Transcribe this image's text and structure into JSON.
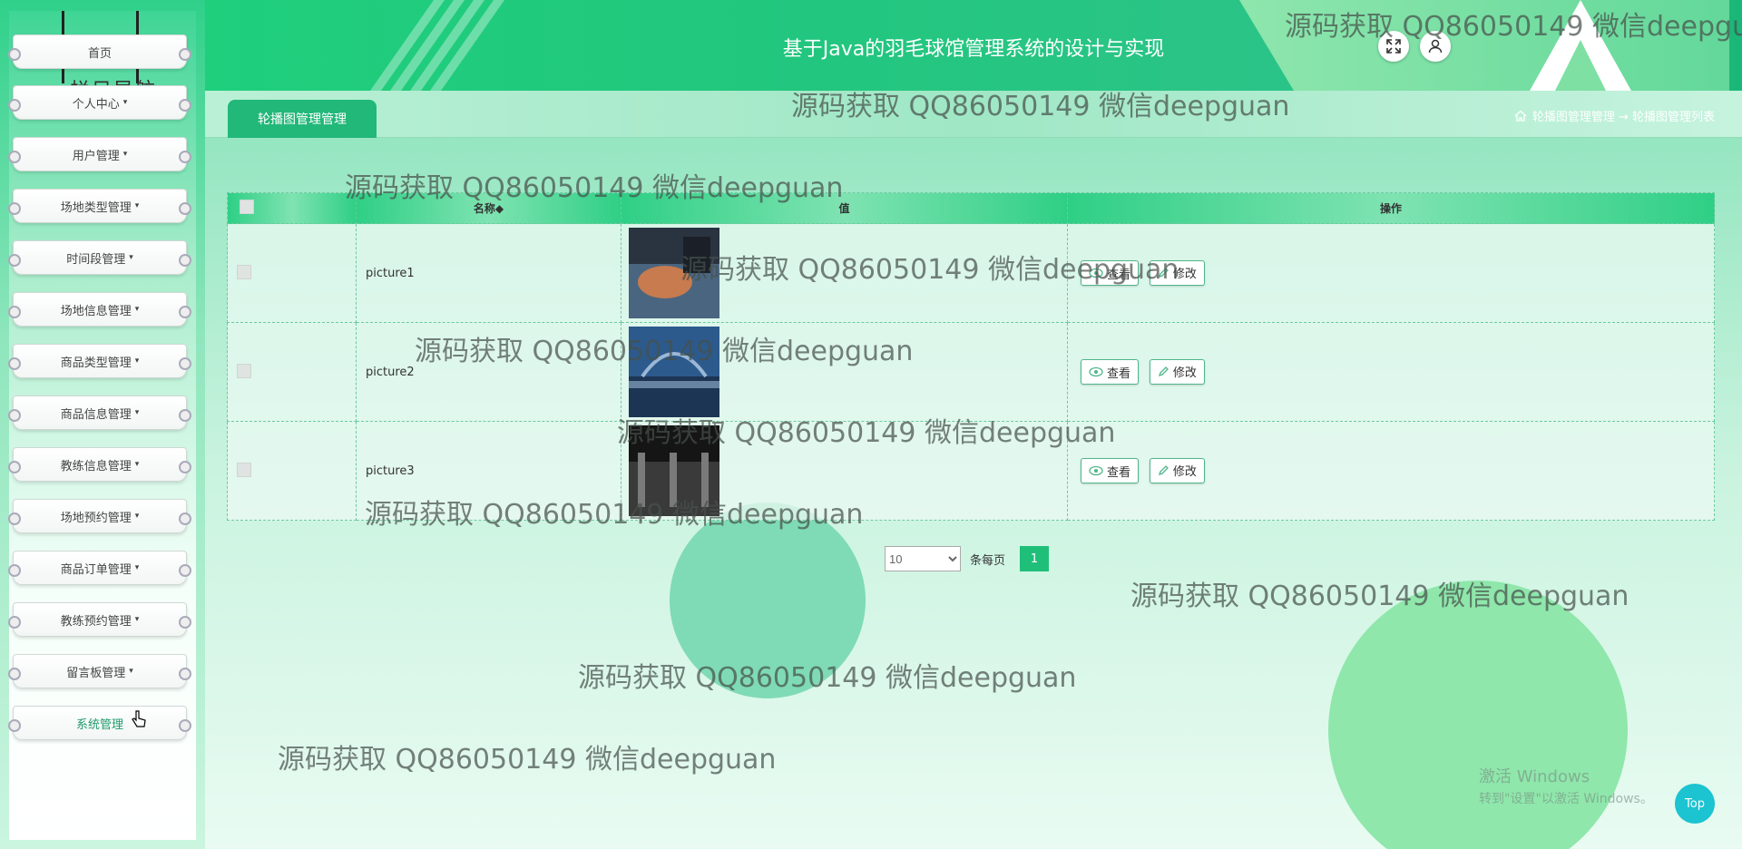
{
  "header": {
    "title": "基于Java的羽毛球馆管理系统的设计与实现",
    "fullscreen_icon": "expand-icon",
    "user_icon": "user-icon"
  },
  "sidebar": {
    "title": "栏目导航",
    "items": [
      {
        "label": "首页",
        "caret": ""
      },
      {
        "label": "个人中心",
        "caret": "▾"
      },
      {
        "label": "用户管理",
        "caret": "▾"
      },
      {
        "label": "场地类型管理",
        "caret": "▾"
      },
      {
        "label": "时间段管理",
        "caret": "▾"
      },
      {
        "label": "场地信息管理",
        "caret": "▾"
      },
      {
        "label": "商品类型管理",
        "caret": "▾"
      },
      {
        "label": "商品信息管理",
        "caret": "▾"
      },
      {
        "label": "教练信息管理",
        "caret": "▾"
      },
      {
        "label": "场地预约管理",
        "caret": "▾"
      },
      {
        "label": "商品订单管理",
        "caret": "▾"
      },
      {
        "label": "教练预约管理",
        "caret": "▾"
      },
      {
        "label": "留言板管理",
        "caret": "▾"
      },
      {
        "label": "系统管理",
        "caret": ""
      }
    ]
  },
  "tabs": [
    {
      "label": "轮播图管理管理"
    }
  ],
  "breadcrumb": {
    "text": "轮播图管理管理 → 轮播图管理列表"
  },
  "table": {
    "headers": [
      "名称◆",
      "值",
      "操作"
    ],
    "rows": [
      {
        "name": "picture1",
        "view": "查看",
        "edit": "修改",
        "thumb_colors": [
          "#2a3440",
          "#c77b4e",
          "#4a6580"
        ]
      },
      {
        "name": "picture2",
        "view": "查看",
        "edit": "修改",
        "thumb_colors": [
          "#2d5a8c",
          "#9ab8d6",
          "#1c3554"
        ]
      },
      {
        "name": "picture3",
        "view": "查看",
        "edit": "修改",
        "thumb_colors": [
          "#151515",
          "#7a7a7a",
          "#3a3a3a"
        ]
      }
    ]
  },
  "pagination": {
    "page_size": "10",
    "per_page_label": "条每页",
    "current_page": "1"
  },
  "watermark_text": "源码获取 QQ86050149 微信deepguan",
  "windows_notice": {
    "line1": "激活 Windows",
    "line2": "转到\"设置\"以激活 Windows。"
  },
  "top_button": "Top",
  "colors": {
    "primary": "#21b879",
    "header": "#22c67e",
    "top_button": "#1cc3d1"
  }
}
